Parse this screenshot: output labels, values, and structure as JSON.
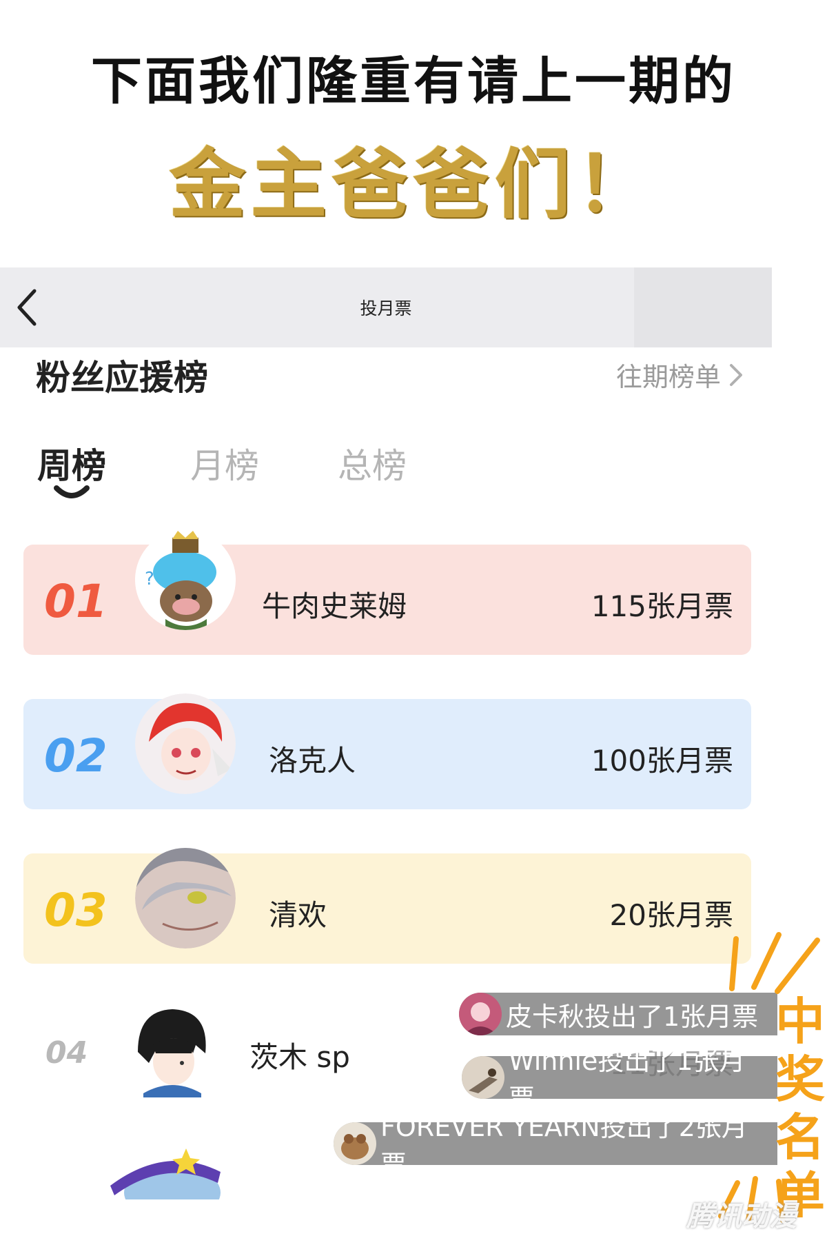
{
  "headline": {
    "line1": "下面我们隆重有请上一期的",
    "line2": "金主爸爸们！"
  },
  "navbar": {
    "title": "投月票"
  },
  "panel": {
    "title": "粉丝应援榜",
    "history_link": "往期榜单"
  },
  "tabs": [
    {
      "label": "周榜",
      "active": true
    },
    {
      "label": "月榜",
      "active": false
    },
    {
      "label": "总榜",
      "active": false
    }
  ],
  "ranks": [
    {
      "rank": "01",
      "name": "牛肉史莱姆",
      "votes": "115张月票",
      "bg": "#fbe1dd",
      "rank_color": "#ef5a40"
    },
    {
      "rank": "02",
      "name": "洛克人",
      "votes": "100张月票",
      "bg": "#e0edfc",
      "rank_color": "#4a9ff0"
    },
    {
      "rank": "03",
      "name": "清欢",
      "votes": "20张月票",
      "bg": "#fdf3d6",
      "rank_color": "#f3c21d"
    },
    {
      "rank": "04",
      "name": "茨木 sp",
      "votes": "11张月票"
    }
  ],
  "toasts": [
    {
      "text": "皮卡秋投出了1张月票"
    },
    {
      "text": "Winnie投出了1张月票"
    },
    {
      "text": "FOREVER YEARN投出了2张月票"
    }
  ],
  "winner_label": "中奖名单",
  "watermark": "腾讯动漫",
  "colors": {
    "gold": "#c9a13c",
    "orange": "#f5a21a"
  }
}
